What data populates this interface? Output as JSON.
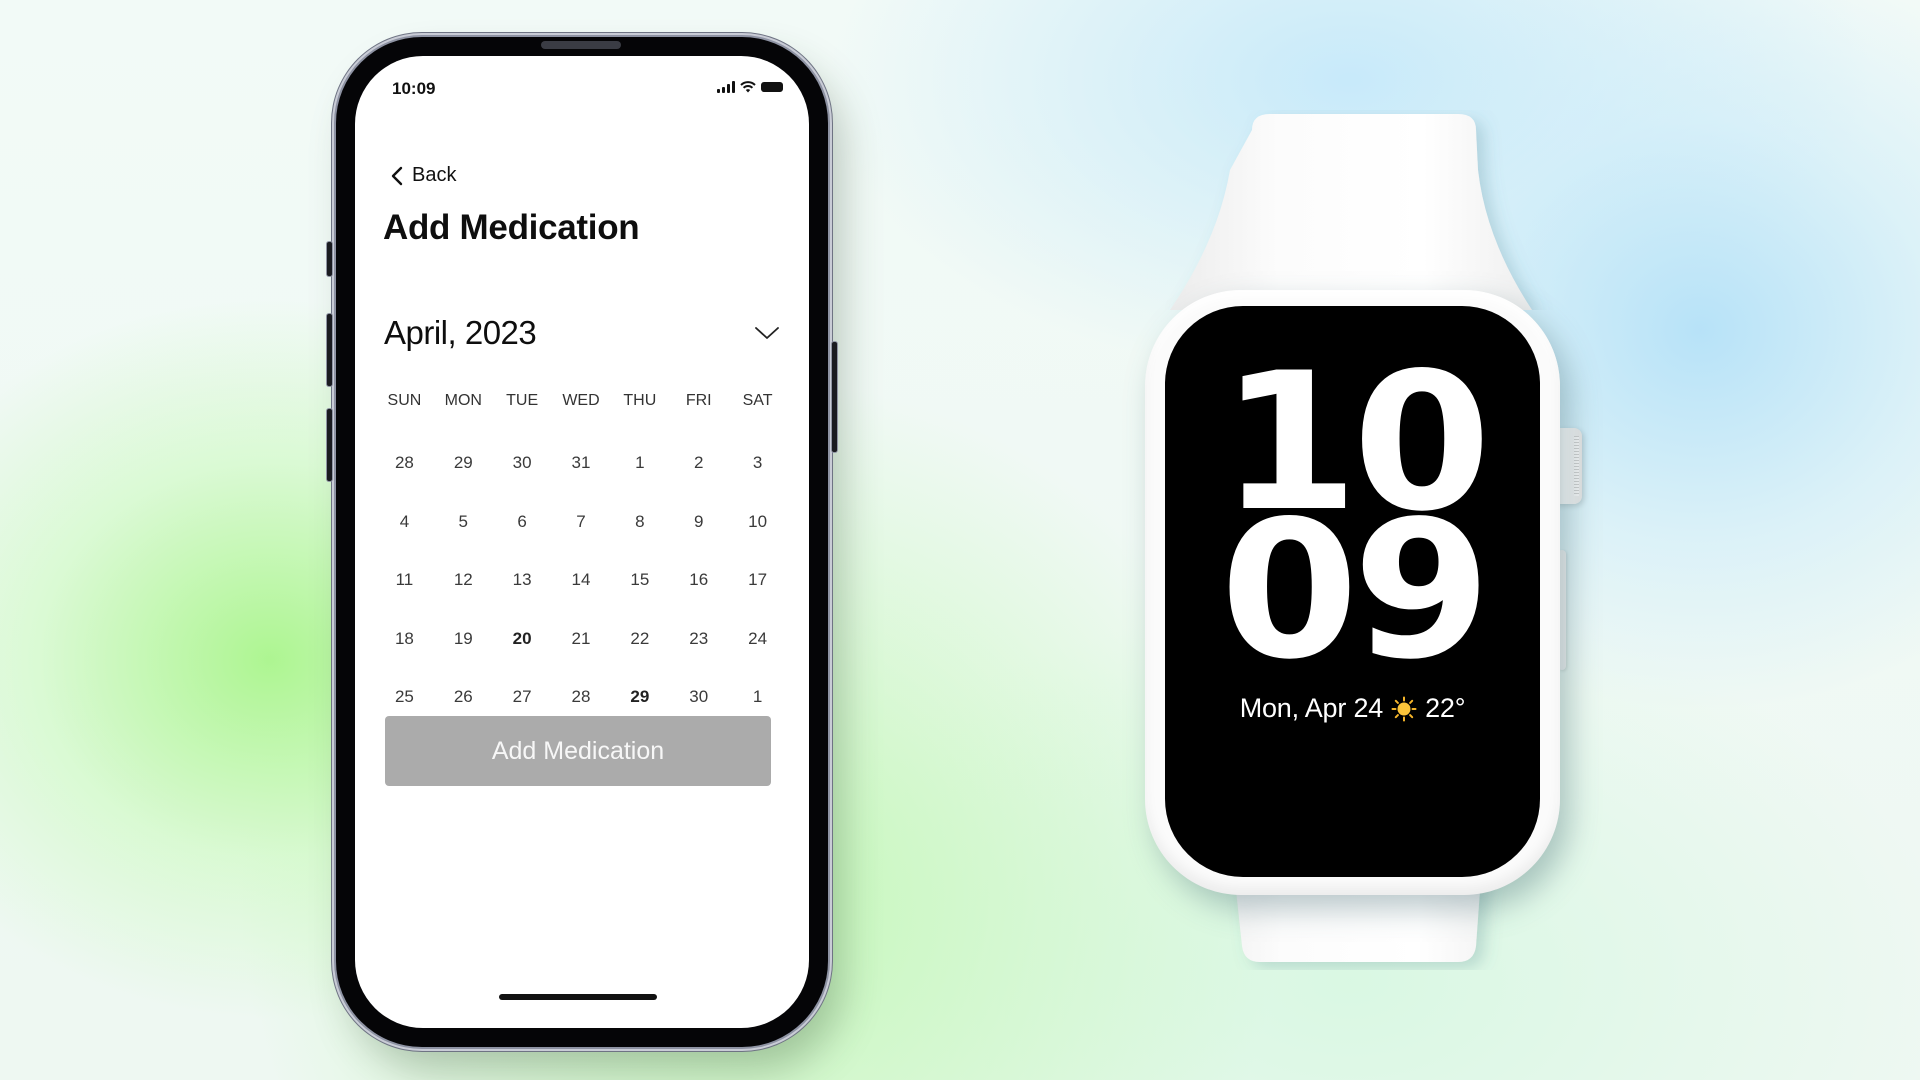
{
  "phone": {
    "status_bar": {
      "time": "10:09",
      "icons": [
        "cellular-signal-icon",
        "wifi-icon",
        "battery-icon"
      ]
    },
    "nav": {
      "back_label": "Back",
      "back_icon": "chevron-left-icon"
    },
    "title": "Add Medication",
    "calendar": {
      "month_label": "April, 2023",
      "dropdown_icon": "chevron-down-icon",
      "weekdays": [
        "SUN",
        "MON",
        "TUE",
        "WED",
        "THU",
        "FRI",
        "SAT"
      ],
      "weeks": [
        [
          "28",
          "29",
          "30",
          "31",
          "1",
          "2",
          "3"
        ],
        [
          "4",
          "5",
          "6",
          "7",
          "8",
          "9",
          "10"
        ],
        [
          "11",
          "12",
          "13",
          "14",
          "15",
          "16",
          "17"
        ],
        [
          "18",
          "19",
          "20",
          "21",
          "22",
          "23",
          "24"
        ],
        [
          "25",
          "26",
          "27",
          "28",
          "29",
          "30",
          "1"
        ]
      ],
      "emphasized_days": [
        "20",
        "29"
      ]
    },
    "primary_button": {
      "label": "Add Medication",
      "state": "disabled",
      "color": "#ababab"
    }
  },
  "watch": {
    "hour": "10",
    "minute": "09",
    "date": "Mon, Apr 24",
    "weather_icon": "sun-icon",
    "temperature": "22°"
  },
  "colors": {
    "background_green": "#bff7a9",
    "background_blue": "#c3e8f9",
    "phone_frame": "#050507",
    "watch_screen": "#000000",
    "watch_body": "#fbfbfb"
  }
}
